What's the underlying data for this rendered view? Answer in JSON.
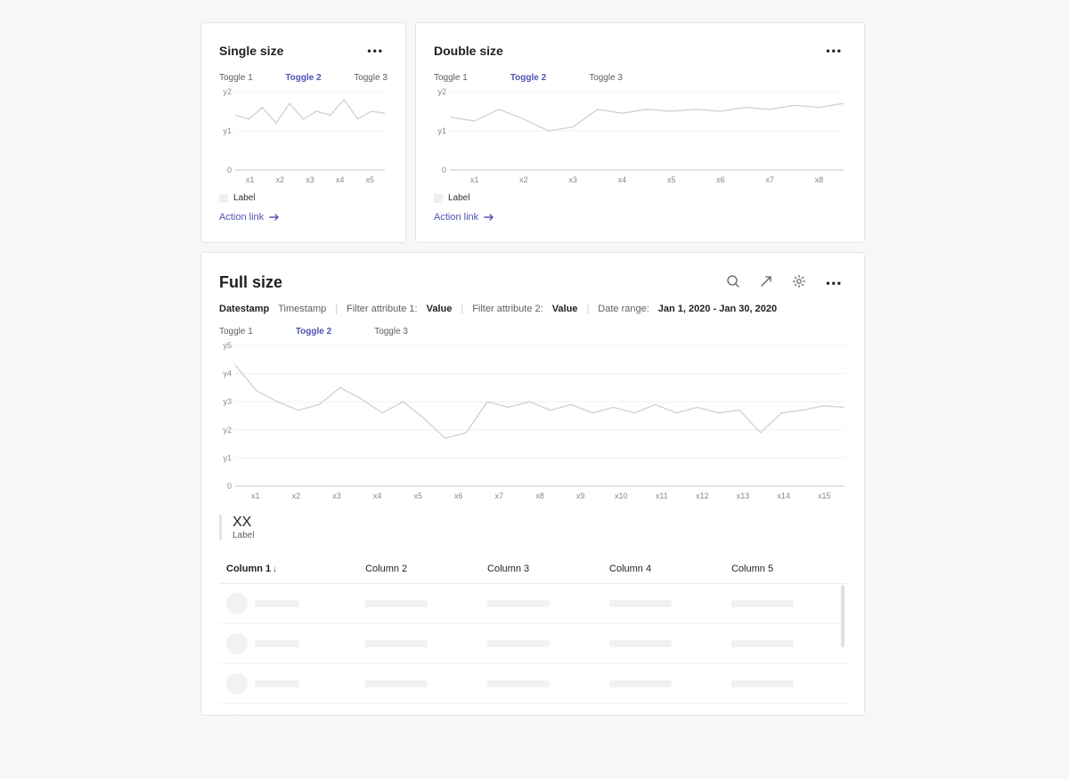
{
  "cards": {
    "single": {
      "title": "Single size",
      "toggles": [
        "Toggle 1",
        "Toggle 2",
        "Toggle 3"
      ],
      "activeToggle": 1,
      "legend": "Label",
      "action": "Action link"
    },
    "double": {
      "title": "Double size",
      "toggles": [
        "Toggle 1",
        "Toggle 2",
        "Toggle 3"
      ],
      "activeToggle": 1,
      "legend": "Label",
      "action": "Action link"
    },
    "full": {
      "title": "Full size",
      "toggles": [
        "Toggle 1",
        "Toggle 2",
        "Toggle 3"
      ],
      "activeToggle": 1,
      "filters": {
        "tab1": "Datestamp",
        "tab2": "Timestamp",
        "attr1label": "Filter attribute 1:",
        "attr1value": "Value",
        "attr2label": "Filter attribute 2:",
        "attr2value": "Value",
        "rangeLabel": "Date range:",
        "rangeValue": "Jan 1, 2020 - Jan 30, 2020"
      },
      "stat": {
        "value": "XX",
        "label": "Label"
      },
      "columns": [
        "Column 1",
        "Column 2",
        "Column 3",
        "Column 4",
        "Column 5"
      ],
      "sortCol": 0
    }
  },
  "chart_data": [
    {
      "type": "line",
      "card": "single",
      "categories": [
        "x1",
        "x2",
        "x3",
        "x4",
        "x5"
      ],
      "ylabels": [
        "0",
        "y1",
        "y2"
      ],
      "ylim": [
        0,
        2
      ],
      "series": [
        {
          "name": "Label",
          "values": [
            1.4,
            1.3,
            1.6,
            1.2,
            1.7,
            1.3,
            1.5,
            1.4,
            1.8,
            1.3,
            1.5,
            1.45
          ]
        }
      ]
    },
    {
      "type": "line",
      "card": "double",
      "categories": [
        "x1",
        "x2",
        "x3",
        "x4",
        "x5",
        "x6",
        "x7",
        "x8"
      ],
      "ylabels": [
        "0",
        "y1",
        "y2"
      ],
      "ylim": [
        0,
        2
      ],
      "series": [
        {
          "name": "Label",
          "values": [
            1.35,
            1.25,
            1.55,
            1.3,
            1.0,
            1.1,
            1.55,
            1.45,
            1.55,
            1.5,
            1.55,
            1.5,
            1.6,
            1.55,
            1.65,
            1.6,
            1.7
          ]
        }
      ]
    },
    {
      "type": "line",
      "card": "full",
      "categories": [
        "x1",
        "x2",
        "x3",
        "x4",
        "x5",
        "x6",
        "x7",
        "x8",
        "x9",
        "x10",
        "x11",
        "x12",
        "x13",
        "x14",
        "x15"
      ],
      "ylabels": [
        "0",
        "y1",
        "y2",
        "y3",
        "y4",
        "y5"
      ],
      "ylim": [
        0,
        5
      ],
      "series": [
        {
          "name": "Label",
          "values": [
            4.3,
            3.4,
            3.0,
            2.7,
            2.9,
            3.5,
            3.1,
            2.6,
            3.0,
            2.4,
            1.7,
            1.9,
            3.0,
            2.8,
            3.0,
            2.7,
            2.9,
            2.6,
            2.8,
            2.6,
            2.9,
            2.6,
            2.8,
            2.6,
            2.7,
            1.9,
            2.6,
            2.7,
            2.85,
            2.8
          ]
        }
      ]
    }
  ]
}
